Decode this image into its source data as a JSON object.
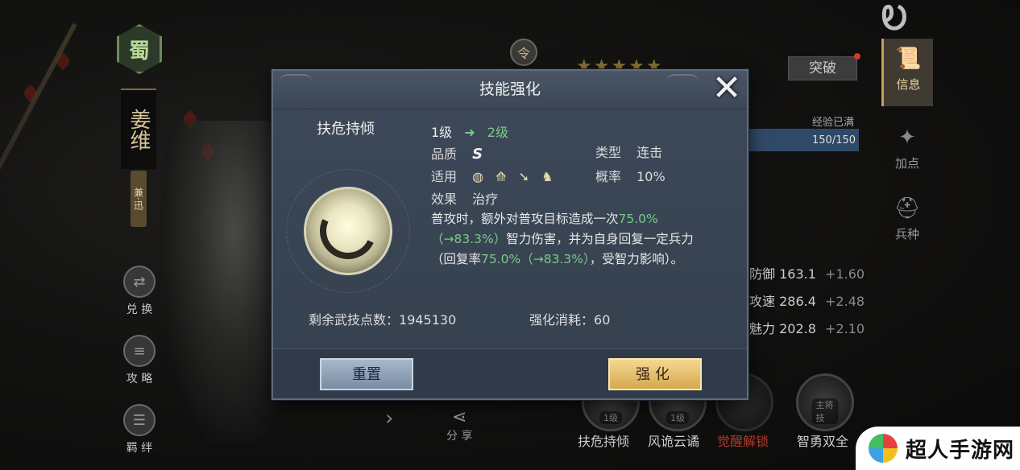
{
  "background": {
    "faction_char": "蜀",
    "hero_name": "姜维",
    "hero_tag": "兼·迅",
    "left_buttons": [
      {
        "label": "兑 换",
        "icon": "exchange-icon"
      },
      {
        "label": "攻 略",
        "icon": "scroll-icon"
      },
      {
        "label": "羁 绊",
        "icon": "bond-icon"
      }
    ],
    "token_char": "令",
    "stars": "★★★★★",
    "breakthrough_label": "突破",
    "exp_label": "经验已满",
    "exp_value": "150/150",
    "stats": [
      {
        "label": "防御",
        "value": "163.1",
        "inc": "+1.60"
      },
      {
        "label": "攻速",
        "value": "286.4",
        "inc": "+2.48"
      },
      {
        "label": "魅力",
        "value": "202.8",
        "inc": "+2.10"
      }
    ],
    "side_tabs": [
      {
        "label": "信息",
        "icon": "scroll-icon"
      },
      {
        "label": "加点",
        "icon": "points-icon"
      },
      {
        "label": "兵种",
        "icon": "helmet-icon"
      }
    ],
    "skills": [
      {
        "name": "扶危持倾",
        "level": "1级"
      },
      {
        "name": "风诡云谲",
        "level": "1级"
      },
      {
        "name": "觉醒解锁",
        "level": ""
      },
      {
        "name": "智勇双全",
        "level": "主将技"
      }
    ],
    "share_label": "分 享",
    "brand_text": "超人手游网",
    "colors": {
      "accent_green": "#7acb8a",
      "gold_button": "#d4a850",
      "panel_bg": "#3a4554"
    }
  },
  "modal": {
    "title": "技能强化",
    "skill_name": "扶危持倾",
    "level_from": "1级",
    "level_to": "2级",
    "quality_label": "品质",
    "quality_value": "S",
    "type_label": "类型",
    "type_value": "连击",
    "apply_label": "适用",
    "apply_icons": [
      "shield-icon",
      "bow-icon",
      "spear-icon",
      "horse-icon"
    ],
    "rate_label": "概率",
    "rate_value": "10%",
    "effect_label": "效果",
    "effect_value": "治疗",
    "desc_parts": {
      "p1": "普攻时，额外对普攻目标造成一次",
      "g1": "75.0%",
      "g2": "（→83.3%）",
      "p2": "智力伤害，并为自身回复一定兵力",
      "p3": "（回复率",
      "g3": "75.0%（→83.3%）",
      "p4": "，受智力影响）。"
    },
    "remaining_label": "剩余武技点数：",
    "remaining_value": "1945130",
    "cost_label": "强化消耗：",
    "cost_value": "60",
    "reset_label": "重置",
    "enhance_label": "强化"
  }
}
